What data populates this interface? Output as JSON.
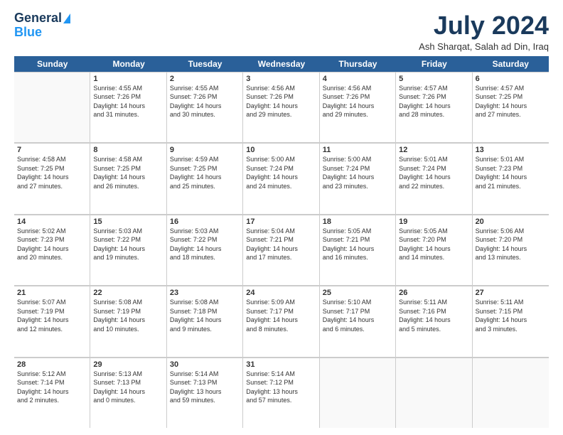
{
  "header": {
    "logo_line1": "General",
    "logo_line2": "Blue",
    "month_title": "July 2024",
    "location": "Ash Sharqat, Salah ad Din, Iraq"
  },
  "calendar": {
    "days_of_week": [
      "Sunday",
      "Monday",
      "Tuesday",
      "Wednesday",
      "Thursday",
      "Friday",
      "Saturday"
    ],
    "rows": [
      [
        {
          "day": "",
          "info": ""
        },
        {
          "day": "1",
          "info": "Sunrise: 4:55 AM\nSunset: 7:26 PM\nDaylight: 14 hours\nand 31 minutes."
        },
        {
          "day": "2",
          "info": "Sunrise: 4:55 AM\nSunset: 7:26 PM\nDaylight: 14 hours\nand 30 minutes."
        },
        {
          "day": "3",
          "info": "Sunrise: 4:56 AM\nSunset: 7:26 PM\nDaylight: 14 hours\nand 29 minutes."
        },
        {
          "day": "4",
          "info": "Sunrise: 4:56 AM\nSunset: 7:26 PM\nDaylight: 14 hours\nand 29 minutes."
        },
        {
          "day": "5",
          "info": "Sunrise: 4:57 AM\nSunset: 7:26 PM\nDaylight: 14 hours\nand 28 minutes."
        },
        {
          "day": "6",
          "info": "Sunrise: 4:57 AM\nSunset: 7:25 PM\nDaylight: 14 hours\nand 27 minutes."
        }
      ],
      [
        {
          "day": "7",
          "info": "Sunrise: 4:58 AM\nSunset: 7:25 PM\nDaylight: 14 hours\nand 27 minutes."
        },
        {
          "day": "8",
          "info": "Sunrise: 4:58 AM\nSunset: 7:25 PM\nDaylight: 14 hours\nand 26 minutes."
        },
        {
          "day": "9",
          "info": "Sunrise: 4:59 AM\nSunset: 7:25 PM\nDaylight: 14 hours\nand 25 minutes."
        },
        {
          "day": "10",
          "info": "Sunrise: 5:00 AM\nSunset: 7:24 PM\nDaylight: 14 hours\nand 24 minutes."
        },
        {
          "day": "11",
          "info": "Sunrise: 5:00 AM\nSunset: 7:24 PM\nDaylight: 14 hours\nand 23 minutes."
        },
        {
          "day": "12",
          "info": "Sunrise: 5:01 AM\nSunset: 7:24 PM\nDaylight: 14 hours\nand 22 minutes."
        },
        {
          "day": "13",
          "info": "Sunrise: 5:01 AM\nSunset: 7:23 PM\nDaylight: 14 hours\nand 21 minutes."
        }
      ],
      [
        {
          "day": "14",
          "info": "Sunrise: 5:02 AM\nSunset: 7:23 PM\nDaylight: 14 hours\nand 20 minutes."
        },
        {
          "day": "15",
          "info": "Sunrise: 5:03 AM\nSunset: 7:22 PM\nDaylight: 14 hours\nand 19 minutes."
        },
        {
          "day": "16",
          "info": "Sunrise: 5:03 AM\nSunset: 7:22 PM\nDaylight: 14 hours\nand 18 minutes."
        },
        {
          "day": "17",
          "info": "Sunrise: 5:04 AM\nSunset: 7:21 PM\nDaylight: 14 hours\nand 17 minutes."
        },
        {
          "day": "18",
          "info": "Sunrise: 5:05 AM\nSunset: 7:21 PM\nDaylight: 14 hours\nand 16 minutes."
        },
        {
          "day": "19",
          "info": "Sunrise: 5:05 AM\nSunset: 7:20 PM\nDaylight: 14 hours\nand 14 minutes."
        },
        {
          "day": "20",
          "info": "Sunrise: 5:06 AM\nSunset: 7:20 PM\nDaylight: 14 hours\nand 13 minutes."
        }
      ],
      [
        {
          "day": "21",
          "info": "Sunrise: 5:07 AM\nSunset: 7:19 PM\nDaylight: 14 hours\nand 12 minutes."
        },
        {
          "day": "22",
          "info": "Sunrise: 5:08 AM\nSunset: 7:19 PM\nDaylight: 14 hours\nand 10 minutes."
        },
        {
          "day": "23",
          "info": "Sunrise: 5:08 AM\nSunset: 7:18 PM\nDaylight: 14 hours\nand 9 minutes."
        },
        {
          "day": "24",
          "info": "Sunrise: 5:09 AM\nSunset: 7:17 PM\nDaylight: 14 hours\nand 8 minutes."
        },
        {
          "day": "25",
          "info": "Sunrise: 5:10 AM\nSunset: 7:17 PM\nDaylight: 14 hours\nand 6 minutes."
        },
        {
          "day": "26",
          "info": "Sunrise: 5:11 AM\nSunset: 7:16 PM\nDaylight: 14 hours\nand 5 minutes."
        },
        {
          "day": "27",
          "info": "Sunrise: 5:11 AM\nSunset: 7:15 PM\nDaylight: 14 hours\nand 3 minutes."
        }
      ],
      [
        {
          "day": "28",
          "info": "Sunrise: 5:12 AM\nSunset: 7:14 PM\nDaylight: 14 hours\nand 2 minutes."
        },
        {
          "day": "29",
          "info": "Sunrise: 5:13 AM\nSunset: 7:13 PM\nDaylight: 14 hours\nand 0 minutes."
        },
        {
          "day": "30",
          "info": "Sunrise: 5:14 AM\nSunset: 7:13 PM\nDaylight: 13 hours\nand 59 minutes."
        },
        {
          "day": "31",
          "info": "Sunrise: 5:14 AM\nSunset: 7:12 PM\nDaylight: 13 hours\nand 57 minutes."
        },
        {
          "day": "",
          "info": ""
        },
        {
          "day": "",
          "info": ""
        },
        {
          "day": "",
          "info": ""
        }
      ]
    ]
  }
}
